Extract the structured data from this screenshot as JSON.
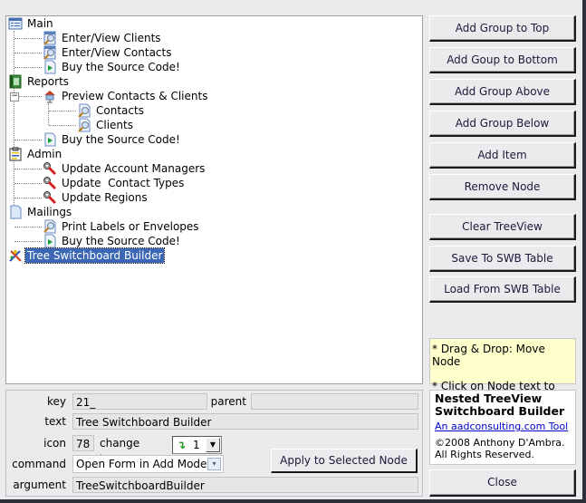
{
  "tree": {
    "nodes": [
      {
        "label": "Main",
        "icon": "switchboard-group-icon",
        "level": 0
      },
      {
        "label": "Enter/View Clients",
        "icon": "form-search-icon",
        "level": 1
      },
      {
        "label": "Enter/View Contacts",
        "icon": "form-search-icon",
        "level": 1
      },
      {
        "label": "Buy the Source Code!",
        "icon": "play-document-icon",
        "level": 1
      },
      {
        "label": "Reports",
        "icon": "report-book-icon",
        "level": 0
      },
      {
        "label": "Preview Contacts & Clients",
        "icon": "house-group-icon",
        "level": 1,
        "expanded": true
      },
      {
        "label": "Contacts",
        "icon": "report-search-icon",
        "level": 2
      },
      {
        "label": "Clients",
        "icon": "report-search-icon",
        "level": 2
      },
      {
        "label": "Buy the Source Code!",
        "icon": "play-document-icon",
        "level": 1
      },
      {
        "label": "Admin",
        "icon": "clipboard-icon",
        "level": 0
      },
      {
        "label": "Update Account Managers",
        "icon": "wrench-icon",
        "level": 1
      },
      {
        "label": "Update  Contact Types",
        "icon": "wrench-icon",
        "level": 1
      },
      {
        "label": "Update Regions",
        "icon": "wrench-icon",
        "level": 1
      },
      {
        "label": "Mailings",
        "icon": "blank-document-icon",
        "level": 0
      },
      {
        "label": "Print Labels or Envelopes",
        "icon": "magnifier-document-icon",
        "level": 1
      },
      {
        "label": "Buy the Source Code!",
        "icon": "play-document-icon",
        "level": 1
      },
      {
        "label": "Tree Switchboard Builder",
        "icon": "tools-icon",
        "level": 0,
        "selected": true
      }
    ]
  },
  "buttons": {
    "add_group_top": "Add Group to Top",
    "add_group_bottom": "Add Goup to Bottom",
    "add_group_above": "Add Group Above",
    "add_group_below": "Add Group Below",
    "add_item": "Add Item",
    "remove_node": "Remove Node",
    "clear_treeview": "Clear TreeView",
    "save_table": "Save To SWB Table",
    "load_table": "Load From SWB Table",
    "apply": "Apply to Selected Node",
    "close": "Close"
  },
  "notes": {
    "drag_drop": "* Drag & Drop: Move Node",
    "click_edit": "* Click on Node text to edit"
  },
  "about": {
    "title_line1": "Nested TreeView",
    "title_line2": "Switchboard Builder",
    "link": "An aadconsulting.com Tool",
    "copyright_line1": "©2008 Anthony D'Ambra.",
    "copyright_line2": "All Rights Reserved."
  },
  "properties": {
    "key_label": "key",
    "key_value": "21_",
    "parent_label": "parent",
    "parent_value": "",
    "text_label": "text",
    "text_value": "Tree Switchboard Builder",
    "icon_label": "icon",
    "icon_value": "78",
    "change_icon_label": "change icon:",
    "change_icon_value": "1",
    "command_label": "command",
    "command_value": "Open Form in Add Mode",
    "argument_label": "argument",
    "argument_value": "TreeSwitchboardBuilder"
  },
  "colors": {
    "selection": "#3c67b5",
    "note_bg": "#ffffcc",
    "link": "#0000cc"
  }
}
